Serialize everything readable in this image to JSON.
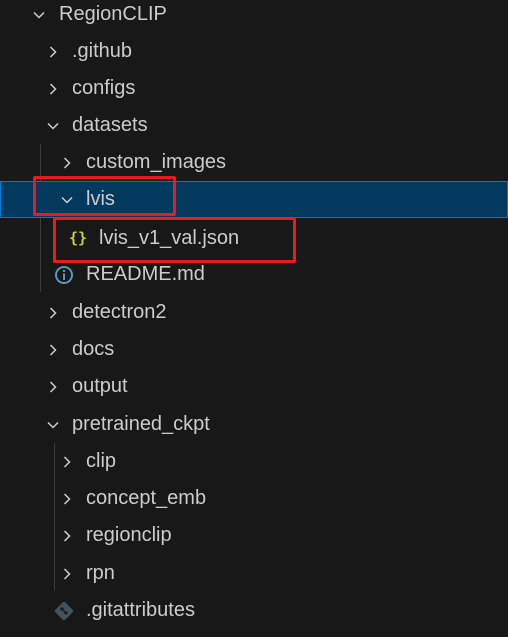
{
  "tree": {
    "root": "RegionCLIP",
    "github": ".github",
    "configs": "configs",
    "datasets": "datasets",
    "custom_images": "custom_images",
    "lvis": "lvis",
    "lvis_json": "lvis_v1_val.json",
    "readme": "README.md",
    "detectron2": "detectron2",
    "docs": "docs",
    "output": "output",
    "pretrained_ckpt": "pretrained_ckpt",
    "clip": "clip",
    "concept_emb": "concept_emb",
    "regionclip": "regionclip",
    "rpn": "rpn",
    "gitattributes": ".gitattributes"
  },
  "icons": {
    "json": "{}",
    "readme": "info-icon",
    "gitattributes": "git-icon"
  },
  "colors": {
    "background": "#181818",
    "selection": "#04395e",
    "text": "#cccccc",
    "json_icon": "#cbcb41",
    "info_icon": "#519aba",
    "git_icon": "#41535b",
    "annotation": "#e81b23"
  }
}
